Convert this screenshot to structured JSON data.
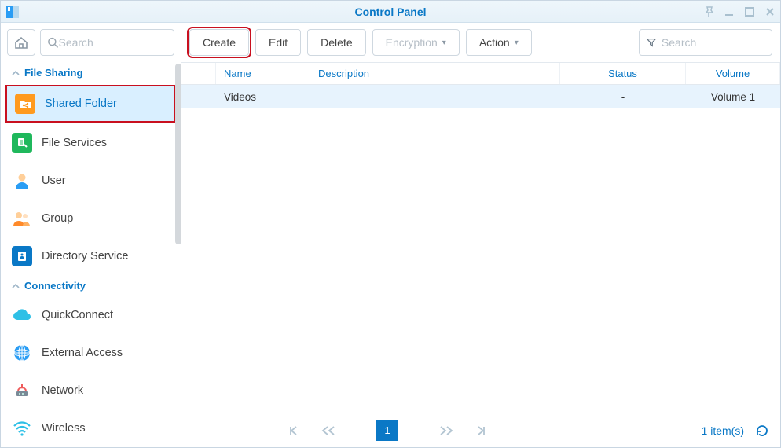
{
  "window": {
    "title": "Control Panel"
  },
  "sidebar": {
    "search_placeholder": "Search",
    "sections": [
      {
        "label": "File Sharing",
        "items": [
          {
            "label": "Shared Folder",
            "active": true
          },
          {
            "label": "File Services"
          },
          {
            "label": "User"
          },
          {
            "label": "Group"
          },
          {
            "label": "Directory Service"
          }
        ]
      },
      {
        "label": "Connectivity",
        "items": [
          {
            "label": "QuickConnect"
          },
          {
            "label": "External Access"
          },
          {
            "label": "Network"
          },
          {
            "label": "Wireless"
          }
        ]
      }
    ]
  },
  "toolbar": {
    "create": "Create",
    "edit": "Edit",
    "delete": "Delete",
    "encryption": "Encryption",
    "action": "Action",
    "search_placeholder": "Search"
  },
  "table": {
    "columns": {
      "name": "Name",
      "description": "Description",
      "status": "Status",
      "volume": "Volume"
    },
    "rows": [
      {
        "name": "Videos",
        "description": "",
        "status": "-",
        "volume": "Volume 1"
      }
    ]
  },
  "pager": {
    "page": "1",
    "count_label": "1 item(s)"
  }
}
